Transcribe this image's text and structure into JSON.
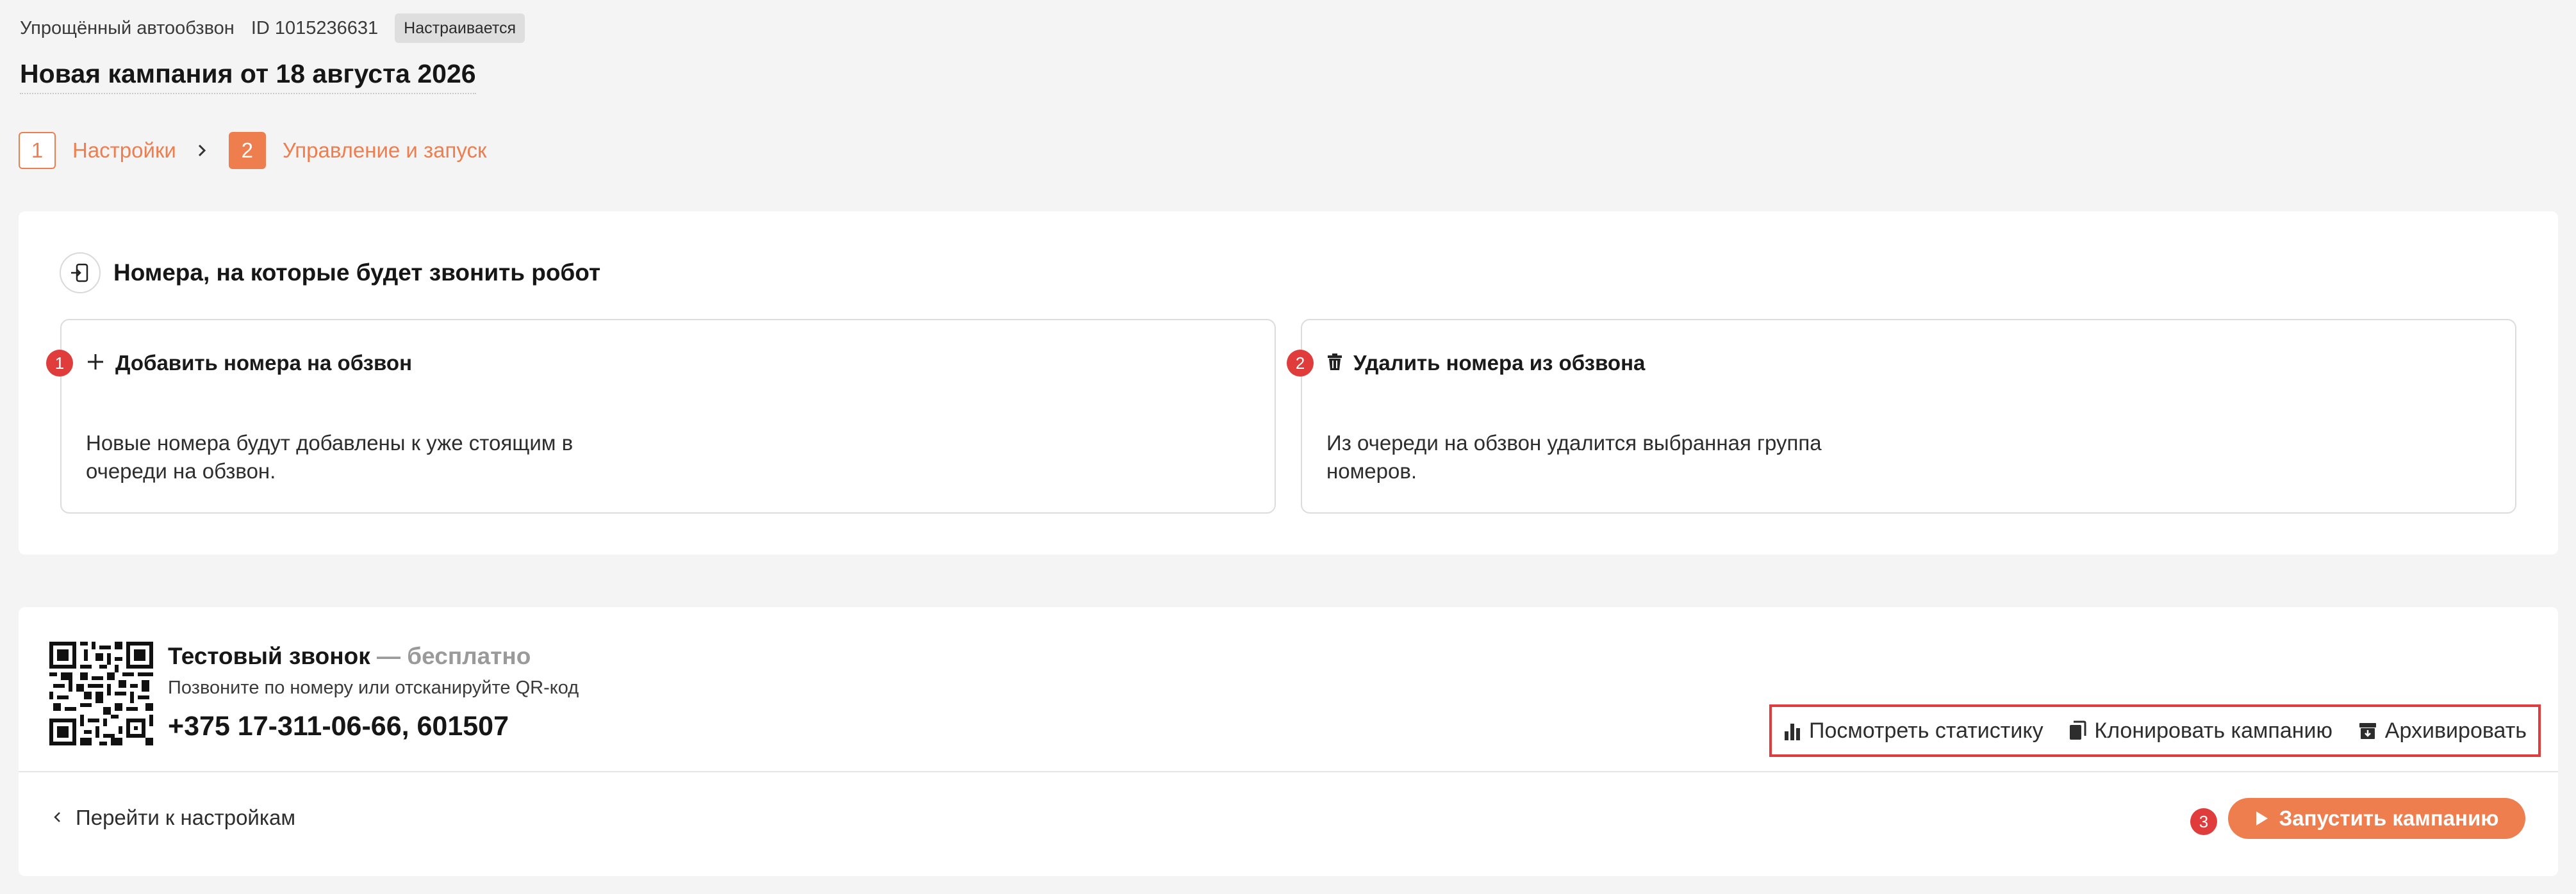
{
  "header": {
    "breadcrumb_title": "Упрощённый автообзвон",
    "campaign_id": "ID 1015236631",
    "status": "Настраивается",
    "page_title": "Новая кампания от 18 августа 2026"
  },
  "stepper": {
    "steps": [
      {
        "num": "1",
        "label": "Настройки",
        "state": "done"
      },
      {
        "num": "2",
        "label": "Управление и запуск",
        "state": "active"
      }
    ],
    "accent_color": "#ef7e4f"
  },
  "numbers_section": {
    "title": "Номера, на которые будет звонить робот",
    "icon": "phone-import-icon",
    "cards": [
      {
        "marker": "1",
        "icon": "plus-icon",
        "title": "Добавить номера на обзвон",
        "desc_line1": "Новые номера будут добавлены к уже стоящим в",
        "desc_line2": "очереди на обзвон."
      },
      {
        "marker": "2",
        "icon": "trash-icon",
        "title": "Удалить номера из обзвона",
        "desc_line1": "Из очереди на обзвон удалится выбранная группа",
        "desc_line2": "номеров."
      }
    ]
  },
  "test_call": {
    "title": "Тестовый звонок",
    "free_suffix": " — бесплатно",
    "subtitle": "Позвоните по номеру или отсканируйте QR-код",
    "phone": "+375 17-311-06-66, 601507"
  },
  "actions": {
    "stats": "Посмотреть статистику",
    "clone": "Клонировать кампанию",
    "archive": "Архивировать"
  },
  "footer": {
    "back": "Перейти к настройкам",
    "marker": "3",
    "launch": "Запустить кампанию"
  }
}
